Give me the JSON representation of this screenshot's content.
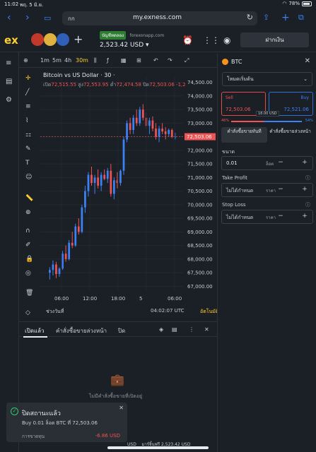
{
  "status_bar": {
    "time": "11:02",
    "date": "พฤ. 5 มิ.ย.",
    "wifi": "wifi",
    "battery": "78%"
  },
  "browser": {
    "reader_label": "กก",
    "url": "my.exness.com"
  },
  "header": {
    "logo": "ex",
    "account_badge": "บัญชีทดลอง",
    "server": "forexonapp.com",
    "balance": "2,523.42 USD",
    "deposit_label": "ฝากเงิน"
  },
  "chart_toolbar": {
    "timeframes": [
      "1m",
      "5m",
      "4h",
      "30m"
    ],
    "active_timeframe": "30m"
  },
  "chart": {
    "title": "Bitcoin vs US Dollar · 30 ·",
    "ohlc": {
      "open_label": "เปิด",
      "open": "72,515.55",
      "high_label": "สูง",
      "high": "72,553.95",
      "low_label": "ต่ำ",
      "low": "72,474.58",
      "close_label": "ปิด",
      "close": "72,503.06",
      "change": "-1,2"
    },
    "time_range_label": "ช่วงวันที่",
    "clock": "04:02:07 UTC",
    "auto_label": "อัตโนมัติ"
  },
  "chart_data": {
    "type": "candlestick",
    "title": "Bitcoin vs US Dollar · 30",
    "y_ticks": [
      67000,
      67500,
      68000,
      68500,
      69000,
      69500,
      70000,
      70500,
      71000,
      71500,
      72000,
      72500,
      73000,
      73500,
      74000,
      74500
    ],
    "y_tick_labels": [
      "67,000.00",
      "67,500.00",
      "68,000.00",
      "68,500.00",
      "69,000.00",
      "69,500.00",
      "70,000.00",
      "70,500.00",
      "71,000.00",
      "71,500.00",
      "72,000.00",
      "72,500.00",
      "73,000.00",
      "73,500.00",
      "74,000.00",
      "74,500.00"
    ],
    "ylim": [
      66800,
      74700
    ],
    "x_tick_labels": [
      "06:00",
      "12:00",
      "18:00",
      "5",
      "06:00"
    ],
    "current_price": "72,503.06",
    "candles": [
      [
        67500,
        67700,
        67250,
        67600
      ],
      [
        67600,
        67950,
        67400,
        67800
      ],
      [
        67800,
        67900,
        67300,
        67450
      ],
      [
        67450,
        67700,
        67350,
        67650
      ],
      [
        67650,
        68300,
        67600,
        68200
      ],
      [
        68200,
        68500,
        67900,
        68000
      ],
      [
        68000,
        68700,
        67950,
        68600
      ],
      [
        68600,
        69000,
        68400,
        68500
      ],
      [
        68500,
        69300,
        68450,
        69200
      ],
      [
        69200,
        69500,
        68900,
        69000
      ],
      [
        69000,
        70000,
        68950,
        69900
      ],
      [
        69900,
        70700,
        69700,
        70500
      ],
      [
        70500,
        71200,
        70300,
        71100
      ],
      [
        71100,
        71400,
        70700,
        70800
      ],
      [
        70800,
        71100,
        70400,
        71000
      ],
      [
        71000,
        71300,
        70600,
        70700
      ],
      [
        70700,
        71200,
        70500,
        71100
      ],
      [
        71100,
        71300,
        70900,
        70950
      ],
      [
        70950,
        71350,
        70800,
        71250
      ],
      [
        71250,
        71500,
        70300,
        70400
      ],
      [
        70400,
        71000,
        70200,
        70900
      ],
      [
        70900,
        71200,
        70600,
        70800
      ],
      [
        70800,
        71300,
        70700,
        71250
      ],
      [
        71250,
        72500,
        71100,
        72400
      ],
      [
        72400,
        73100,
        72300,
        73000
      ],
      [
        73000,
        73200,
        72600,
        72750
      ],
      [
        72750,
        73300,
        72600,
        73200
      ],
      [
        73200,
        73500,
        72900,
        73000
      ],
      [
        73000,
        73600,
        72900,
        73500
      ],
      [
        73500,
        73700,
        73100,
        73200
      ],
      [
        73200,
        73400,
        72800,
        72900
      ],
      [
        72900,
        73200,
        72600,
        73100
      ],
      [
        73100,
        73250,
        72700,
        72800
      ],
      [
        72800,
        73000,
        72400,
        72500
      ],
      [
        72500,
        72900,
        72300,
        72800
      ],
      [
        72800,
        73000,
        72600,
        72700
      ],
      [
        72700,
        72850,
        72400,
        72600
      ],
      [
        72600,
        72800,
        72500,
        72750
      ],
      [
        72750,
        72800,
        72450,
        72500
      ],
      [
        72500,
        72650,
        72400,
        72503
      ]
    ]
  },
  "order_panel": {
    "symbol": "BTC",
    "mode": "โหมดเริ่มต้น",
    "sell_label": "Sell",
    "sell_price": "72,503.06",
    "buy_label": "Buy",
    "buy_price": "72,521.06",
    "spread": "18.00 USD",
    "sell_pct": "46%",
    "buy_pct": "54%",
    "sell_fraction": 0.46,
    "tab_market": "คำสั่งซื้อขายทันที",
    "tab_pending": "คำสั่งซื้อขายล่วงหน้า",
    "volume_label": "ขนาด",
    "volume": "0.01",
    "volume_unit": "ล็อต",
    "tp_label": "Take Profit",
    "tp_value": "ไม่ได้กำหนด",
    "tp_unit": "ราคา",
    "sl_label": "Stop Loss",
    "sl_value": "ไม่ได้กำหนด",
    "sl_unit": "ราคา"
  },
  "bottom": {
    "tab_open": "เปิดแล้ว",
    "tab_pending": "คำสั่งซื้อขายล่วงหน้า",
    "tab_closed": "ปิด",
    "empty_text": "ไม่มีคำสั่งซื้อขายที่เปิดอยู่"
  },
  "toast": {
    "title": "ปิดสถานะแล้ว",
    "message": "Buy 0.01 ล็อต BTC ที่ 72,503.06",
    "pl_label": "การขาดทุน",
    "pl_value": "-6.86 USD"
  },
  "footer": {
    "currency": "USD",
    "margin_label": "มาร์จิ้นฟรี",
    "margin_value": "2,523.42 USD"
  }
}
